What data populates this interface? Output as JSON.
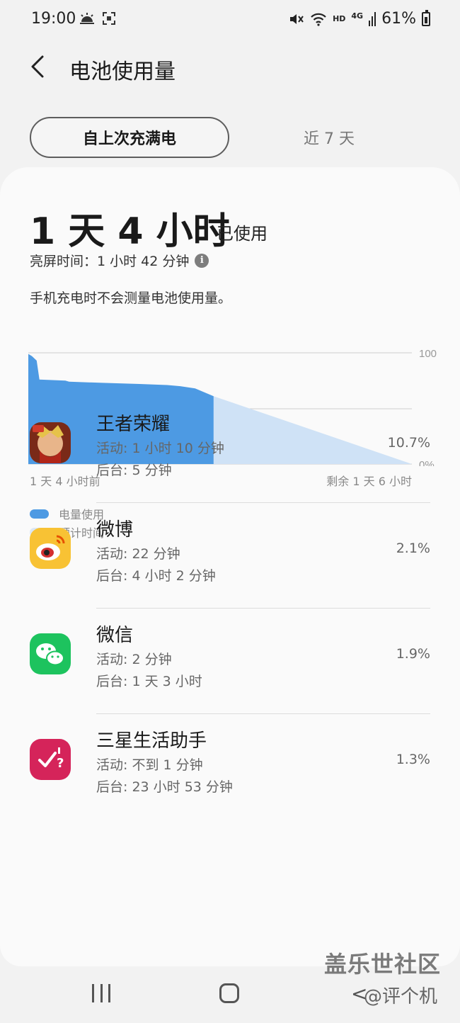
{
  "status_bar": {
    "time": "19:00",
    "network": "HD",
    "cell": "4G",
    "battery_percent": "61%",
    "icons": [
      "weather-sun-icon",
      "screenshot-icon",
      "mute-icon",
      "wifi-icon",
      "signal-icon",
      "battery-icon"
    ]
  },
  "header": {
    "title": "电池使用量",
    "back_icon": "chevron-left-icon"
  },
  "tabs": [
    {
      "label": "自上次充满电",
      "selected": true
    },
    {
      "label": "近 7 天",
      "selected": false
    }
  ],
  "summary": {
    "usage_time": "1 天 4 小时",
    "usage_suffix": "已使用",
    "screen_time": "亮屏时间：1 小时 42 分钟",
    "note": "手机充电时不会测量电池使用量。"
  },
  "colors": {
    "usage": "#4d9ae3",
    "estimate": "#cfe2f6",
    "estimate_legend": "#dbe7f5"
  },
  "chart_data": {
    "type": "area",
    "x_start_label": "1 天 4 小时前",
    "x_end_label": "剩余 1 天 6 小时",
    "y_tick_labels": [
      "100",
      "0%"
    ],
    "ylim": [
      0,
      100
    ],
    "grid": true,
    "series": [
      {
        "name": "电量使用",
        "x": [
          0,
          0.02,
          0.045,
          0.06,
          0.2,
          0.22,
          0.4,
          0.6,
          0.75,
          0.82,
          0.9,
          1.0
        ],
        "values": [
          99,
          97,
          93,
          76,
          75,
          74,
          73,
          72,
          71,
          70,
          68,
          61
        ]
      },
      {
        "name": "预计时间",
        "x": [
          1.0,
          2.07
        ],
        "values": [
          61,
          0
        ]
      }
    ],
    "legend": [
      "电量使用",
      "预计时间"
    ]
  },
  "apps": [
    {
      "name": "王者荣耀",
      "active": "活动: 1 小时 10 分钟",
      "background": "后台: 5 分钟",
      "percent": "10.7%",
      "icon": "honor-of-kings-icon"
    },
    {
      "name": "微博",
      "active": "活动: 22 分钟",
      "background": "后台: 4 小时 2 分钟",
      "percent": "2.1%",
      "icon": "weibo-icon"
    },
    {
      "name": "微信",
      "active": "活动: 2 分钟",
      "background": "后台: 1 天 3 小时",
      "percent": "1.9%",
      "icon": "wechat-icon"
    },
    {
      "name": "三星生活助手",
      "active": "活动: 不到 1 分钟",
      "background": "后台: 23 小时 53 分钟",
      "percent": "1.3%",
      "icon": "samsung-reminder-icon"
    }
  ],
  "watermark": {
    "line1": "盖乐世社区",
    "line2": "@评个机"
  }
}
